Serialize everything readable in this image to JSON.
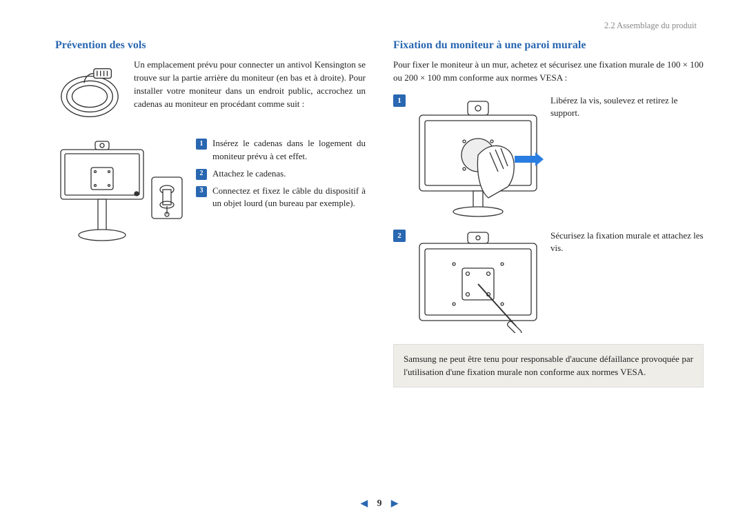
{
  "header": {
    "section": "2.2 Assemblage du produit"
  },
  "left": {
    "heading": "Prévention des vols",
    "intro": "Un emplacement prévu pour connecter un antivol Kensington se trouve sur la partie arrière du moniteur (en bas et à droite). Pour installer votre moniteur dans un endroit public, accrochez un cadenas au moniteur en procédant comme suit :",
    "steps": [
      "Insérez le cadenas dans le logement du moniteur prévu à cet effet.",
      "Attachez le cadenas.",
      "Connectez et fixez le câble du dispositif à un objet lourd (un bureau par exemple)."
    ]
  },
  "right": {
    "heading": "Fixation du moniteur à une paroi murale",
    "intro": "Pour fixer le moniteur à un mur, achetez et sécurisez une fixation murale de 100 × 100 ou 200 × 100 mm conforme aux normes VESA :",
    "steps": [
      "Libérez la vis, soulevez et retirez le support.",
      "Sécurisez la fixation murale et attachez les vis."
    ],
    "note": "Samsung ne peut être tenu pour responsable d'aucune défaillance provoquée par l'utilisation d'une fixation murale non conforme aux normes VESA."
  },
  "pager": {
    "page": "9"
  }
}
